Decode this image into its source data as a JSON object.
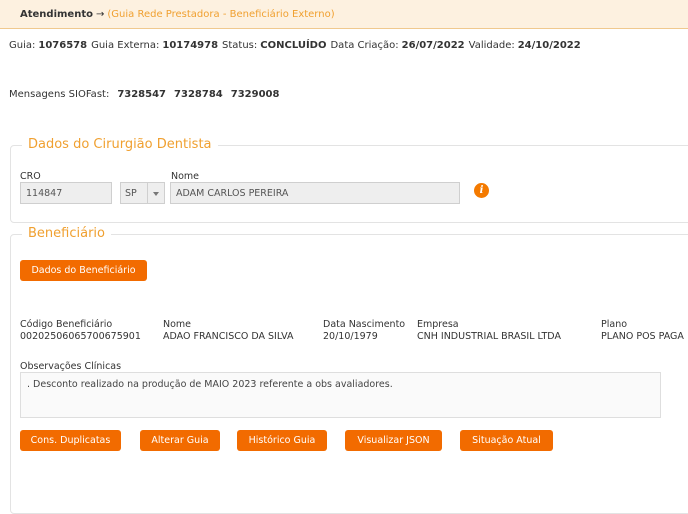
{
  "header": {
    "title": "Atendimento",
    "arrow": "→",
    "subtitle": "(Guia Rede Prestadora - Beneficiário Externo)"
  },
  "guide_info": {
    "guia_label": "Guia:",
    "guia_value": "1076578",
    "externa_label": "Guia Externa:",
    "externa_value": "10174978",
    "status_label": "Status:",
    "status_value": "CONCLUÍDO",
    "criacao_label": "Data Criação:",
    "criacao_value": "26/07/2022",
    "validade_label": "Validade:",
    "validade_value": "24/10/2022"
  },
  "siofast": {
    "label": "Mensagens SIOFast:",
    "messages": [
      "7328547",
      "7328784",
      "7329008"
    ]
  },
  "dentist": {
    "legend": "Dados do Cirurgião Dentista",
    "cro_label": "CRO",
    "cro_value": "114847",
    "uf_value": "SP",
    "name_label": "Nome",
    "name_value": "ADAM CARLOS PEREIRA",
    "info_icon": "i"
  },
  "beneficiary": {
    "legend": "Beneficiário",
    "details_button": "Dados do Beneficiário",
    "columns": [
      {
        "label": "Código Beneficiário",
        "value": "0020250606570067590​1"
      },
      {
        "label": "Nome",
        "value": "ADAO FRANCISCO DA SILVA"
      },
      {
        "label": "Data Nascimento",
        "value": "20/10/1979"
      },
      {
        "label": "Empresa",
        "value": "CNH INDUSTRIAL BRASIL LTDA"
      },
      {
        "label": "Plano",
        "value": "PLANO POS PAGA"
      }
    ],
    "obs_label": "Observações Clínicas",
    "obs_text": ". Desconto realizado na produção de MAIO 2023 referente a obs avaliadores."
  },
  "actions": {
    "duplicatas": "Cons. Duplicatas",
    "alterar": "Alterar Guia",
    "historico": "Histórico Guia",
    "json": "Visualizar JSON",
    "situacao": "Situação Atual"
  }
}
